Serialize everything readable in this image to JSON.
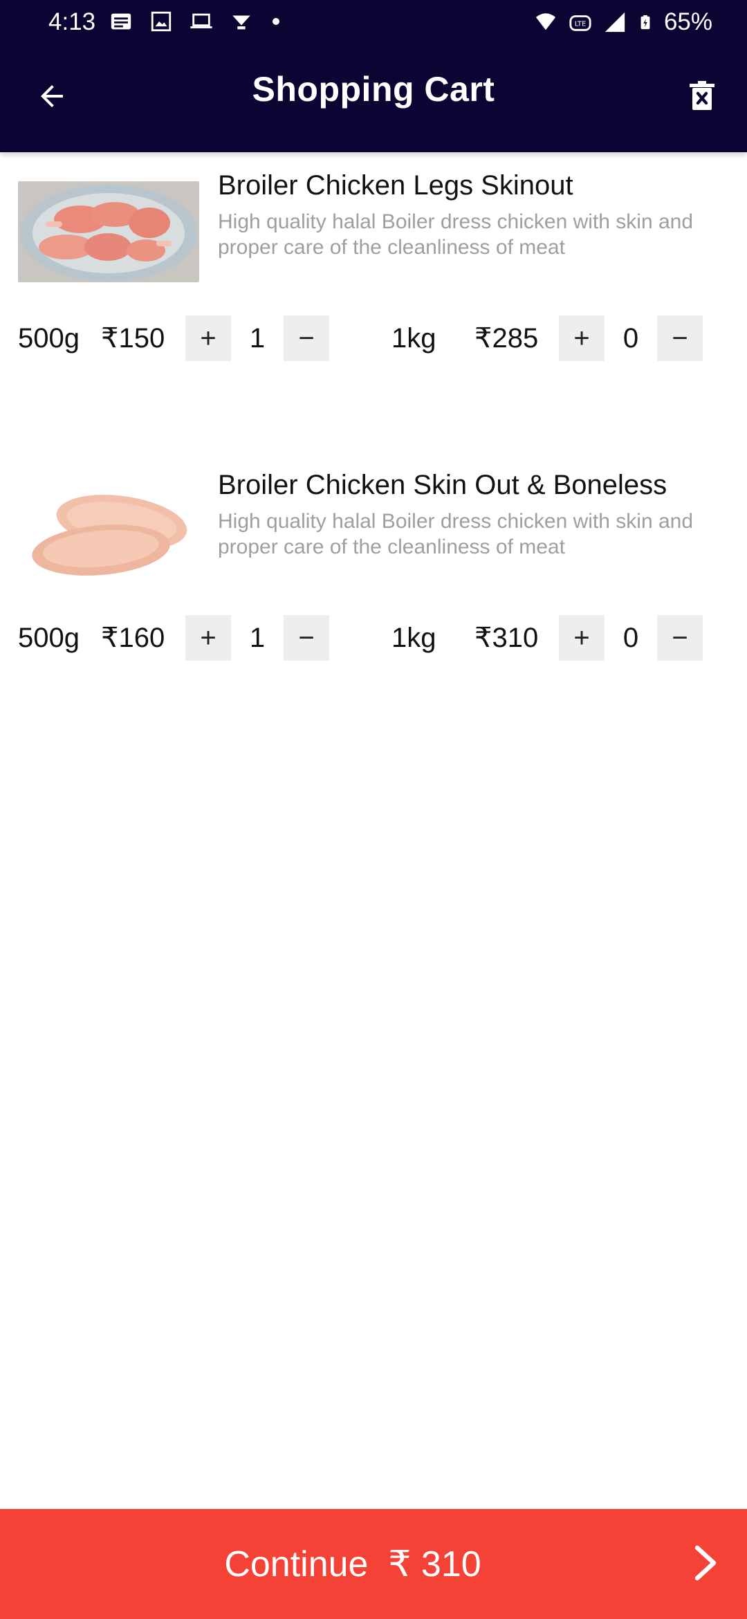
{
  "status_bar": {
    "time": "4:13",
    "battery": "65%",
    "icons_left": [
      "news-icon",
      "image-icon",
      "laptop-icon",
      "vpn-icon"
    ],
    "icons_right": [
      "wifi-icon",
      "volte-icon",
      "signal-icon",
      "battery-icon"
    ]
  },
  "app_bar": {
    "title": "Shopping Cart",
    "back_icon": "arrow-left-icon",
    "action_icon": "delete-icon"
  },
  "items": [
    {
      "title": "Broiler Chicken Legs Skinout",
      "description": "High quality halal Boiler dress chicken with skin and proper care of the cleanliness of meat",
      "variants": [
        {
          "weight": "500g",
          "price": "₹150",
          "qty": "1",
          "plus": "+",
          "minus": "−"
        },
        {
          "weight": "1kg",
          "price": "₹285",
          "qty": "0",
          "plus": "+",
          "minus": "−"
        }
      ]
    },
    {
      "title": "Broiler Chicken Skin Out  & Boneless",
      "description": "High quality halal Boiler dress chicken with skin and proper care of the cleanliness of meat",
      "variants": [
        {
          "weight": "500g",
          "price": "₹160",
          "qty": "1",
          "plus": "+",
          "minus": "−"
        },
        {
          "weight": "1kg",
          "price": "₹310",
          "qty": "0",
          "plus": "+",
          "minus": "−"
        }
      ]
    }
  ],
  "footer": {
    "label": "Continue  ₹ 310",
    "arrow_icon": "chevron-right-icon"
  },
  "colors": {
    "app_bar": "#0c0433",
    "continue_button": "#f44336",
    "qty_button": "#eeeeee",
    "description_text": "#9e9e9e"
  }
}
